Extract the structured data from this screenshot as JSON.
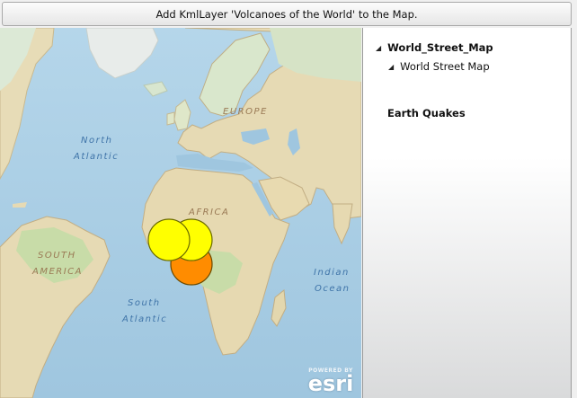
{
  "toolbar": {
    "add_button_label": "Add KmlLayer 'Volcanoes of the World' to the Map."
  },
  "map": {
    "labels": {
      "north_atlantic_1": "North",
      "north_atlantic_2": "Atlantic",
      "europe": "EUROPE",
      "africa": "AFRICA",
      "south_america_1": "SOUTH",
      "south_america_2": "AMERICA",
      "south_atlantic_1": "South",
      "south_atlantic_2": "Atlantic",
      "indian_ocean_1": "Indian",
      "indian_ocean_2": "Ocean"
    },
    "markers": [
      {
        "color": "#ff8c00",
        "name": "orange"
      },
      {
        "color": "#ffff00",
        "name": "yellow"
      },
      {
        "color": "#ffff00",
        "name": "yellow"
      }
    ],
    "attribution": {
      "powered_by": "POWERED BY",
      "brand": "esri"
    }
  },
  "legend": {
    "layers": [
      {
        "title": "World_Street_Map",
        "sublayer": "World Street Map"
      },
      {
        "title": "Earth Quakes"
      }
    ]
  }
}
